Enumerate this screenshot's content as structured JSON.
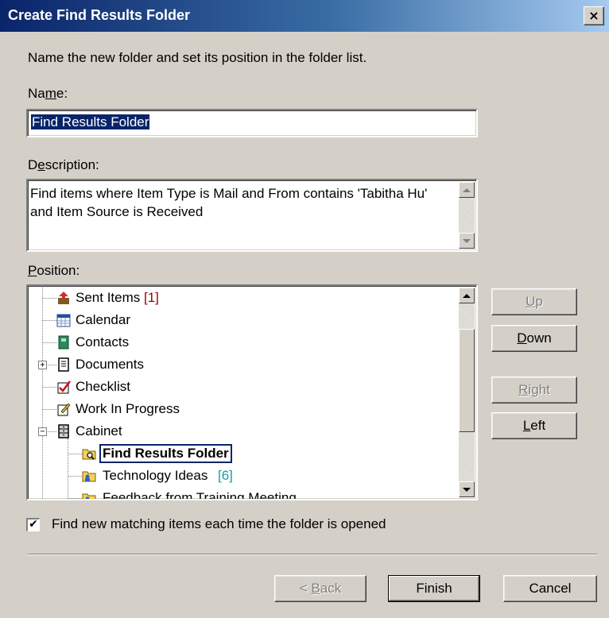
{
  "window": {
    "title": "Create Find Results Folder",
    "close_glyph": "×"
  },
  "instruction": "Name the new folder and set its position in the folder list.",
  "name_field": {
    "label_pre": "Na",
    "label_key": "m",
    "label_post": "e:",
    "value": "Find Results Folder"
  },
  "description_field": {
    "label_pre": "D",
    "label_key": "e",
    "label_post": "scription:",
    "value": "Find items where Item Type is Mail and From  contains 'Tabitha Hu' and Item Source is Received"
  },
  "position": {
    "label_pre": "",
    "label_key": "P",
    "label_post": "osition:",
    "items": [
      {
        "label": "Sent Items",
        "count": "[1]",
        "icon": "sent-items-icon"
      },
      {
        "label": "Calendar",
        "icon": "calendar-icon"
      },
      {
        "label": "Contacts",
        "icon": "contacts-icon"
      },
      {
        "label": "Documents",
        "icon": "documents-icon",
        "expander": "+"
      },
      {
        "label": "Checklist",
        "icon": "checklist-icon"
      },
      {
        "label": "Work In Progress",
        "icon": "work-in-progress-icon"
      },
      {
        "label": "Cabinet",
        "icon": "cabinet-icon",
        "expander": "−"
      },
      {
        "label": "Find Results Folder",
        "icon": "find-results-folder-icon",
        "selected": true
      },
      {
        "label": "Technology Ideas",
        "count": "[6]",
        "icon": "shared-folder-icon"
      },
      {
        "label": "Feedback from Training Meeting",
        "icon": "shared-folder-icon"
      }
    ]
  },
  "buttons": {
    "up": {
      "pre": "",
      "key": "U",
      "post": "p"
    },
    "down": {
      "pre": "",
      "key": "D",
      "post": "own"
    },
    "right": {
      "pre": "",
      "key": "R",
      "post": "ight"
    },
    "left": {
      "pre": "",
      "key": "L",
      "post": "eft"
    },
    "back": {
      "pre": "< ",
      "key": "B",
      "post": "ack"
    },
    "finish": "Finish",
    "cancel": "Cancel"
  },
  "checkbox": {
    "checked": true,
    "mark": "✔",
    "label": "Find new matching items each time the folder is opened"
  },
  "colors": {
    "title_bar": "#0a246a",
    "selection": "#0a246a",
    "dialog_bg": "#d4d0c8",
    "count_red": "#a00000",
    "count_teal": "#1a9aa8"
  }
}
